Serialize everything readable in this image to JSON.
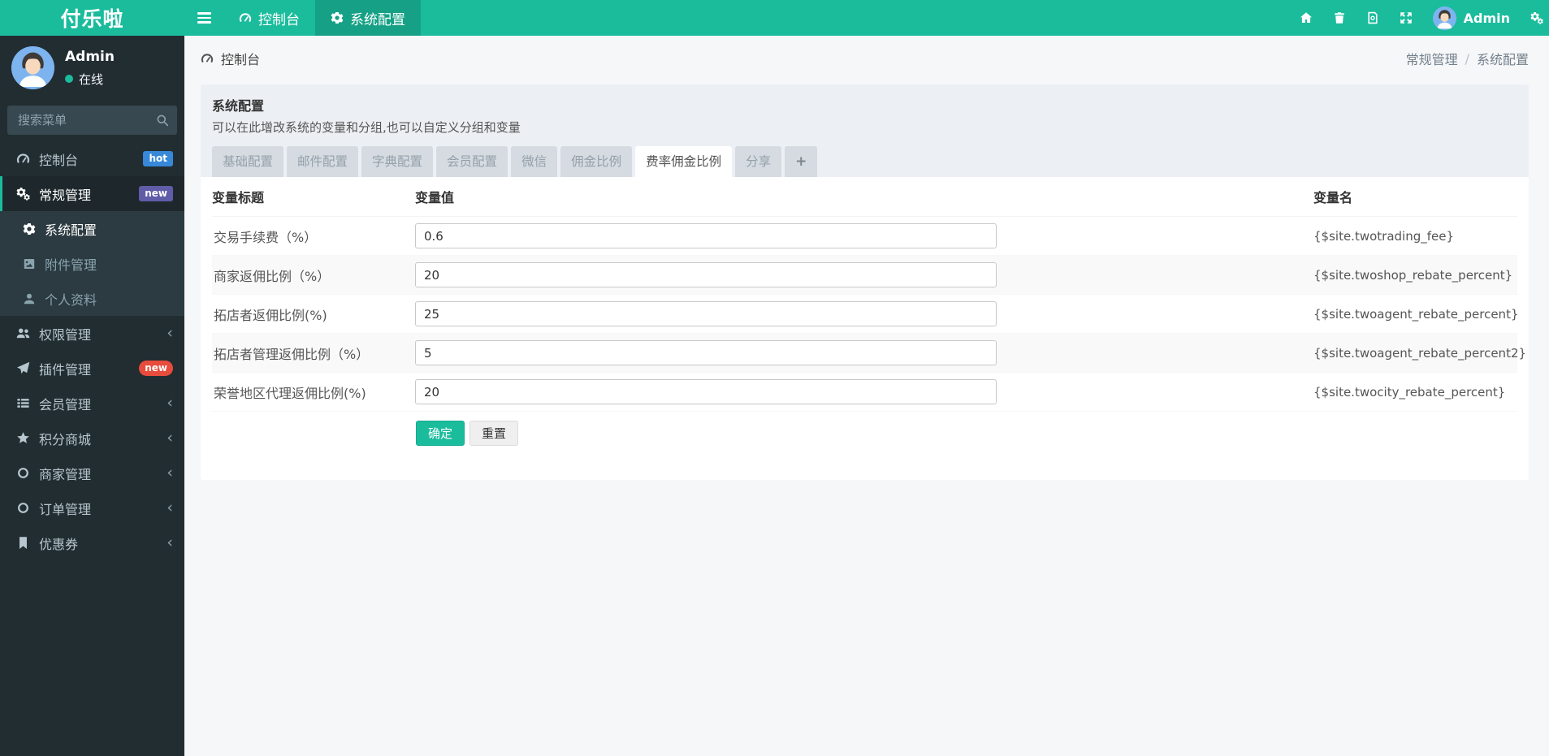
{
  "brand": "付乐啦",
  "topnav": {
    "items": [
      {
        "label": "控制台",
        "icon": "tachometer-icon"
      },
      {
        "label": "系统配置",
        "icon": "gear-icon",
        "active": true
      }
    ],
    "right_icons": [
      "home-icon",
      "trash-icon",
      "log-icon",
      "expand-icon",
      "cogs-icon"
    ],
    "user_name": "Admin"
  },
  "sidebar": {
    "user": {
      "name": "Admin",
      "status": "在线"
    },
    "search_placeholder": "搜索菜单",
    "items": [
      {
        "label": "控制台",
        "icon": "tachometer-icon",
        "badge": "hot",
        "badge_color": "#3788d8"
      },
      {
        "label": "常规管理",
        "icon": "cogs-icon",
        "badge": "new",
        "badge_color": "#605ca8",
        "active": true
      },
      {
        "label": "系统配置",
        "icon": "gear-icon",
        "submenu": true,
        "active": true
      },
      {
        "label": "附件管理",
        "icon": "file-image-icon",
        "submenu": true
      },
      {
        "label": "个人资料",
        "icon": "user-icon",
        "submenu": true
      },
      {
        "label": "权限管理",
        "icon": "users-icon",
        "chevron": "‹"
      },
      {
        "label": "插件管理",
        "icon": "paper-plane-icon",
        "badge": "new",
        "badge_color": "#e74c3c"
      },
      {
        "label": "会员管理",
        "icon": "list-icon",
        "chevron": "‹"
      },
      {
        "label": "积分商城",
        "icon": "star-icon",
        "chevron": "‹"
      },
      {
        "label": "商家管理",
        "icon": "circle-icon",
        "chevron": "‹"
      },
      {
        "label": "订单管理",
        "icon": "circle-icon",
        "chevron": "‹"
      },
      {
        "label": "优惠券",
        "icon": "bookmark-icon",
        "chevron": "‹"
      }
    ]
  },
  "breadcrumb": {
    "left": "控制台",
    "right_parent": "常规管理",
    "separator": "/",
    "right_current": "系统配置"
  },
  "panel": {
    "title": "系统配置",
    "subtitle": "可以在此增改系统的变量和分组,也可以自定义分组和变量",
    "tabs": [
      {
        "label": "基础配置"
      },
      {
        "label": "邮件配置"
      },
      {
        "label": "字典配置"
      },
      {
        "label": "会员配置"
      },
      {
        "label": "微信"
      },
      {
        "label": "佣金比例"
      },
      {
        "label": "费率佣金比例",
        "active": true
      },
      {
        "label": "分享"
      },
      {
        "label": "+"
      }
    ]
  },
  "table": {
    "headers": [
      "变量标题",
      "变量值",
      "变量名"
    ],
    "rows": [
      {
        "title": "交易手续费（%）",
        "value": "0.6",
        "name": "{$site.twotrading_fee}"
      },
      {
        "title": "商家返佣比例（%）",
        "value": "20",
        "name": "{$site.twoshop_rebate_percent}"
      },
      {
        "title": "拓店者返佣比例(%)",
        "value": "25",
        "name": "{$site.twoagent_rebate_percent}"
      },
      {
        "title": "拓店者管理返佣比例（%）",
        "value": "5",
        "name": "{$site.twoagent_rebate_percent2}"
      },
      {
        "title": "荣誉地区代理返佣比例(%)",
        "value": "20",
        "name": "{$site.twocity_rebate_percent}"
      }
    ],
    "buttons": {
      "ok": "确定",
      "reset": "重置"
    }
  },
  "colors": {
    "accent": "#1abc9c",
    "topbar": "#1abc9c",
    "sidebar_bg": "#222d32",
    "submenu_bg": "#2c3b41",
    "panel_bg": "#ecf0f4",
    "badge_hot": "#3788d8",
    "badge_new_purple": "#605ca8",
    "badge_new_red": "#e74c3c"
  }
}
